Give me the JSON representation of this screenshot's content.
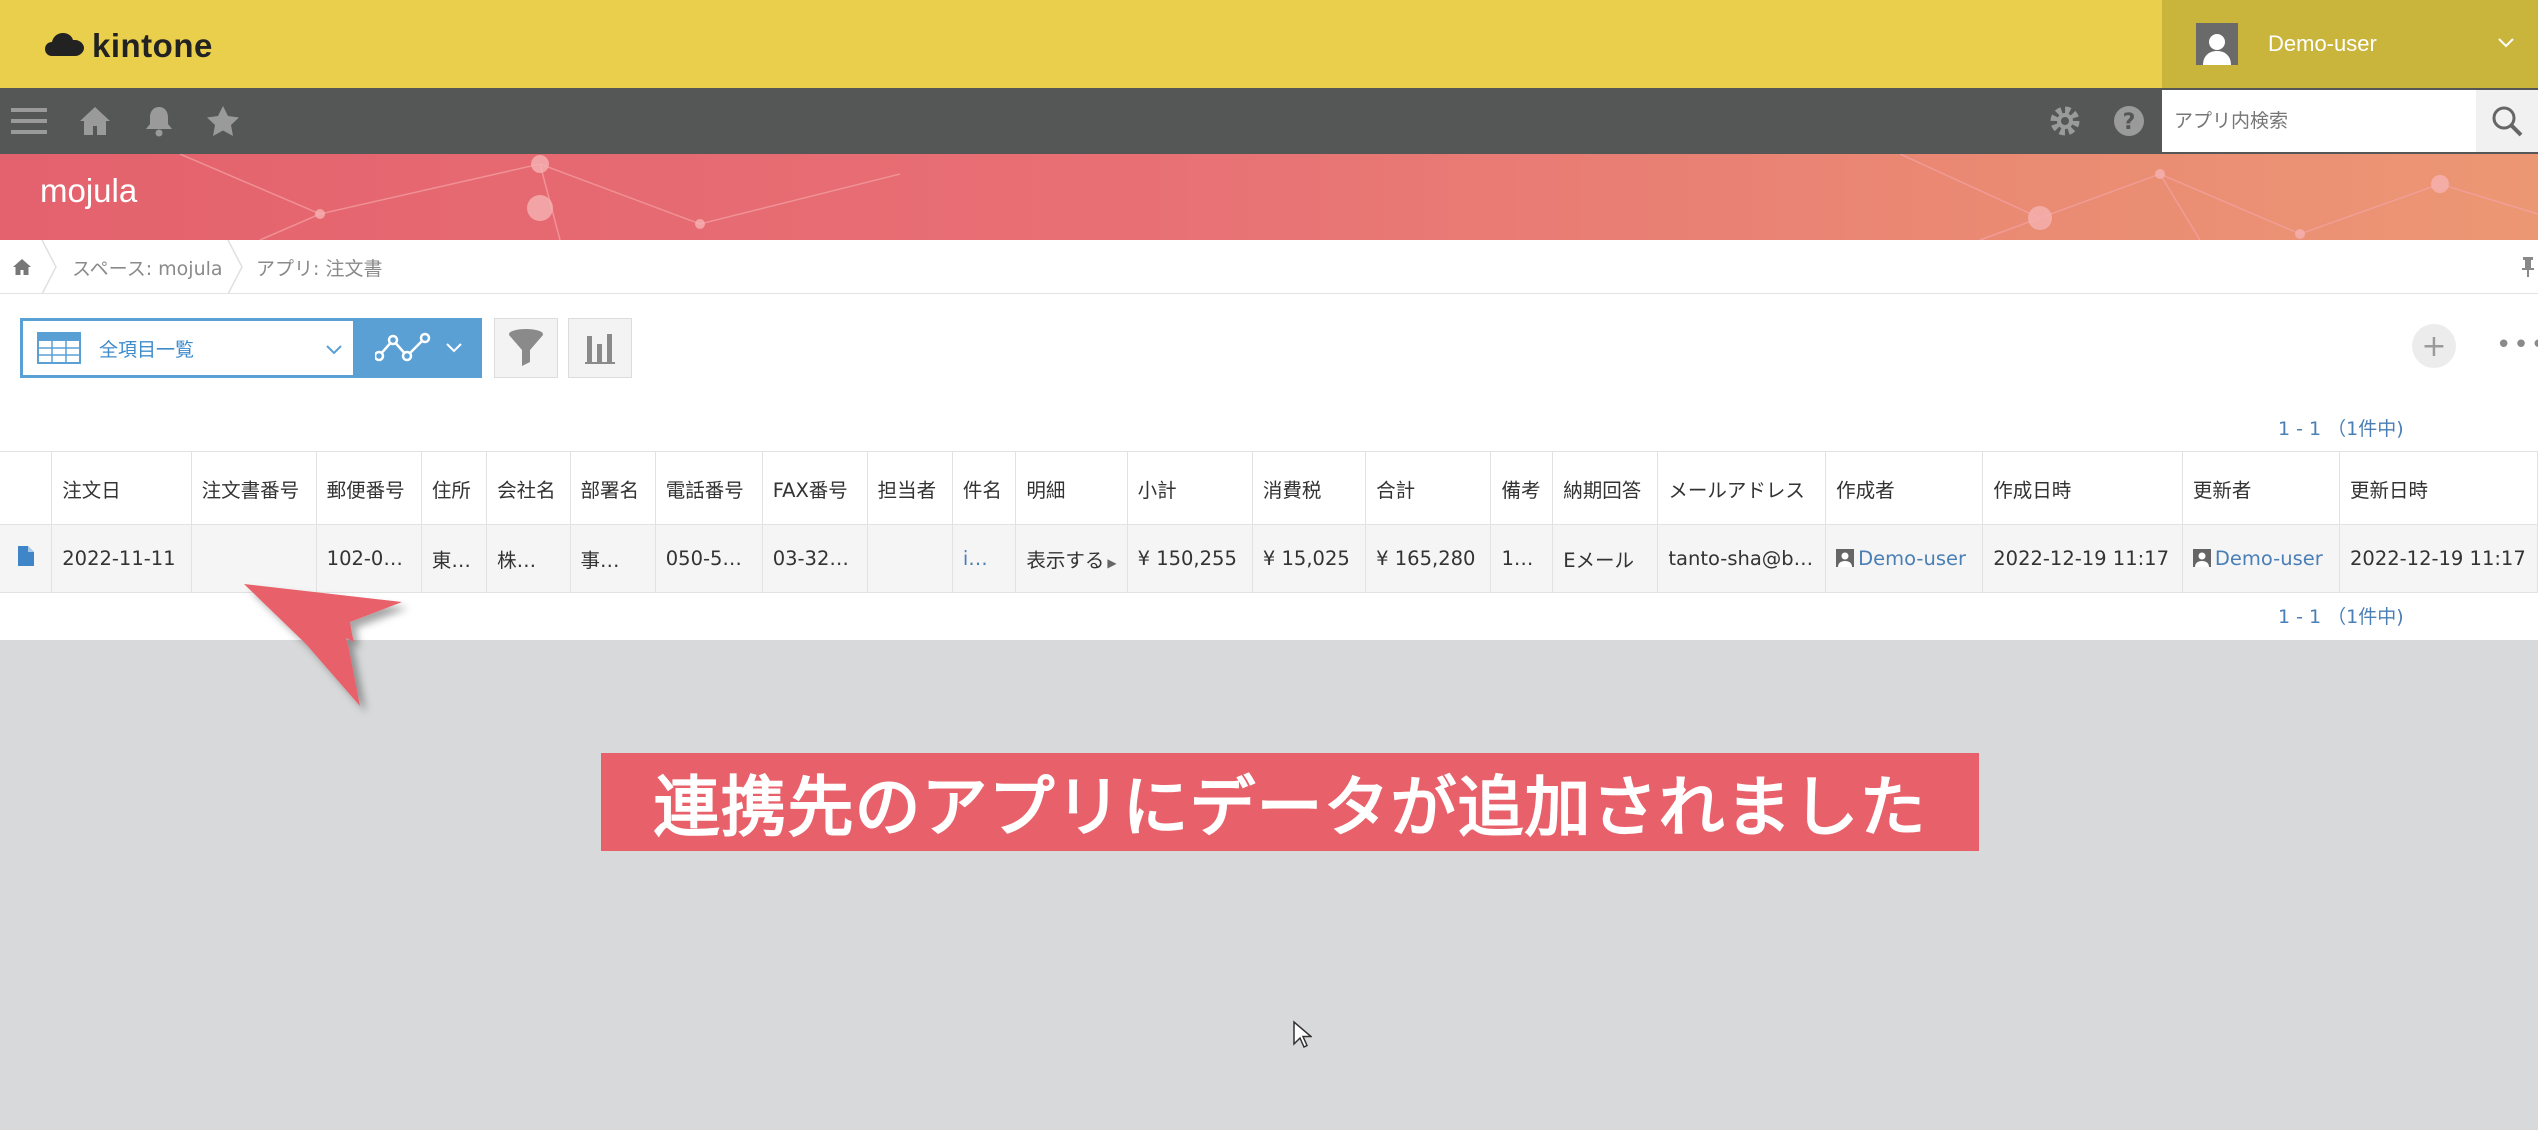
{
  "app": {
    "logo_text": "kintone"
  },
  "user": {
    "name": "Demo-user"
  },
  "search": {
    "placeholder": "アプリ内検索"
  },
  "space": {
    "title": "mojula"
  },
  "breadcrumb": {
    "space": "スペース: mojula",
    "app": "アプリ: 注文書"
  },
  "view": {
    "selected": "全項目一覧"
  },
  "pager": {
    "top": "1 - 1 （1件中)",
    "bottom": "1 - 1 （1件中)"
  },
  "table": {
    "headers": [
      "注文日",
      "注文書番号",
      "郵便番号",
      "住所",
      "会社名",
      "部署名",
      "電話番号",
      "FAX番号",
      "担当者",
      "件名",
      "明細",
      "小計",
      "消費税",
      "合計",
      "備考",
      "納期回答",
      "メールアドレス",
      "作成者",
      "作成日時",
      "更新者",
      "更新日時"
    ],
    "rows": [
      [
        "2022-11-11",
        "",
        "102-0…",
        "東…",
        "株…",
        "事…",
        "050-5…",
        "03-32…",
        "",
        "i…",
        "表示する",
        "¥ 150,255",
        "¥ 15,025",
        "¥ 165,280",
        "1…",
        "Eメール",
        "tanto-sha@b…",
        "Demo-user",
        "2022-12-19 11:17",
        "Demo-user",
        "2022-12-19 11:17"
      ]
    ]
  },
  "caption": "連携先のアプリにデータが追加されました",
  "colors": {
    "topbar": "#e9cf4c",
    "navbar": "#555656",
    "accent": "#5aa0d5",
    "caption_bg": "#e8616a"
  },
  "icons": [
    "menu-icon",
    "home-icon",
    "bell-icon",
    "star-icon",
    "gear-icon",
    "help-icon",
    "search-icon",
    "table-view-icon",
    "chevron-down-icon",
    "graph-icon",
    "filter-icon",
    "chart-bar-icon",
    "record-icon",
    "user-icon",
    "pin-icon"
  ]
}
